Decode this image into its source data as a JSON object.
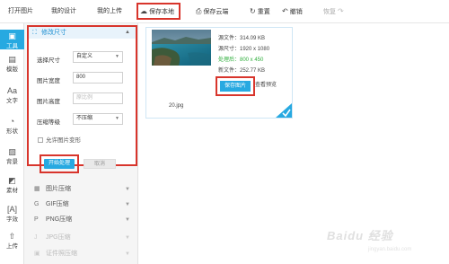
{
  "toolbar": {
    "open_image": "打开图片",
    "my_designs": "我的设计",
    "my_uploads": "我的上传",
    "save_local": "保存本地",
    "save_cloud": "保存云端",
    "reset": "重置",
    "undo": "撤销",
    "redo": "恢复"
  },
  "rail": {
    "tools": "工具",
    "templates": "模版",
    "text": "文字",
    "shapes": "形状",
    "background": "背景",
    "materials": "素材",
    "effects": "字效",
    "upload": "上传"
  },
  "resize_panel": {
    "title": "修改尺寸",
    "select_size_label": "选择尺寸",
    "select_size_value": "自定义",
    "width_label": "图片宽度",
    "width_value": "800",
    "height_label": "图片高度",
    "height_placeholder": "原比例",
    "compress_label": "压缩等级",
    "compress_value": "不压缩",
    "allow_deform": "允许图片变形"
  },
  "actions": {
    "start": "开始处理",
    "cancel": "取消"
  },
  "sections": [
    {
      "label": "图片压缩",
      "icon": "▦"
    },
    {
      "label": "GIF压缩",
      "icon": "G"
    },
    {
      "label": "PNG压缩",
      "icon": "P"
    },
    {
      "label": "JPG压缩",
      "icon": "J"
    },
    {
      "label": "证件照压缩",
      "icon": "▣"
    }
  ],
  "image_card": {
    "orig_file": "源文件：314.09 KB",
    "orig_size": "源尺寸：1920 x 1080",
    "processed": "处理后：800 x 450",
    "new_file": "新文件：252.77 KB",
    "save_image": "保存图片",
    "view_preview": "查看预览",
    "filename": "20.jpg",
    "accent": "#27a9e1",
    "highlight": "#d8352c"
  },
  "watermark": {
    "logo": "Baidu 经验",
    "sub": "jingyan.baidu.com"
  }
}
